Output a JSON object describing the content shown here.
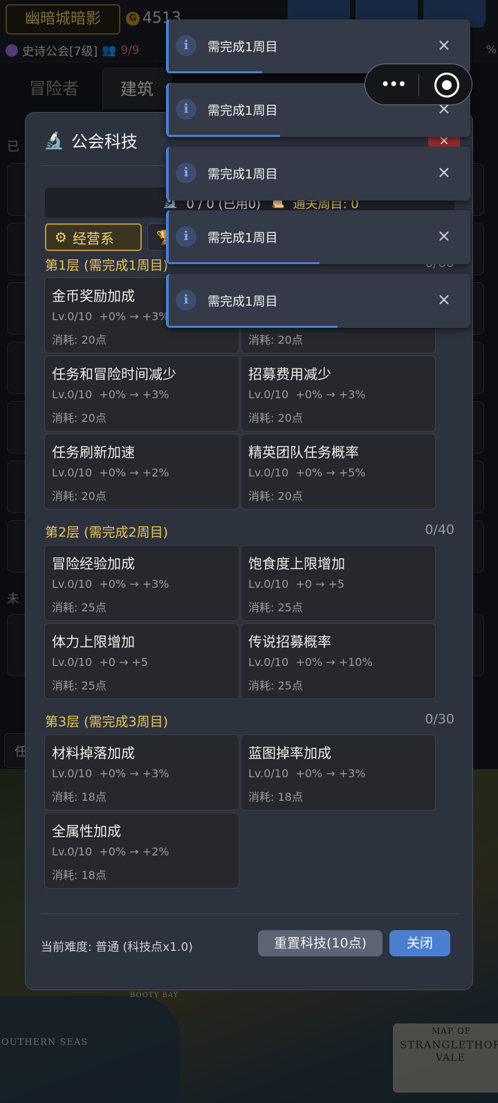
{
  "background": {
    "guild_title": "幽暗城暗影",
    "gold_value": "4513",
    "gold_icon": "G",
    "guild_info": "史诗公会[7级]",
    "member_count": "9/9",
    "percent_suffix": "%",
    "tabs": [
      "冒险者",
      "建筑"
    ],
    "left_label_1": "已",
    "left_label_2": "未",
    "strip_label": "任",
    "map_labels": {
      "southern_seas": "OUTHERN SEAS",
      "booty_bay": "BOOTY BAY",
      "map_of": "MAP OF",
      "region": "STRANGLETHOR",
      "region2": "VALE"
    }
  },
  "modal": {
    "title": "公会科技",
    "close_icon": "close-icon",
    "stats_points": "0 / 0 (已用0)",
    "stats_cycle": "通关周目: 0",
    "system_tabs": [
      {
        "label": "经营系",
        "icon": "gear-icon"
      },
      {
        "label": "",
        "icon": "trophy-icon"
      }
    ],
    "tiers": [
      {
        "title": "第1层 (需完成1周目)",
        "count": "0/60",
        "techs": [
          {
            "name": "金币奖励加成",
            "level": "Lv.0/10",
            "effect": "+0% → +3%",
            "cost": "消耗: 20点"
          },
          {
            "name": "",
            "level": "",
            "effect": "",
            "cost": "消耗: 20点"
          },
          {
            "name": "任务和冒险时间减少",
            "level": "Lv.0/10",
            "effect": "+0% → +3%",
            "cost": "消耗: 20点"
          },
          {
            "name": "招募费用减少",
            "level": "Lv.0/10",
            "effect": "+0% → +3%",
            "cost": "消耗: 20点"
          },
          {
            "name": "任务刷新加速",
            "level": "Lv.0/10",
            "effect": "+0% → +2%",
            "cost": "消耗: 20点"
          },
          {
            "name": "精英团队任务概率",
            "level": "Lv.0/10",
            "effect": "+0% → +5%",
            "cost": "消耗: 20点"
          }
        ]
      },
      {
        "title": "第2层 (需完成2周目)",
        "count": "0/40",
        "techs": [
          {
            "name": "冒险经验加成",
            "level": "Lv.0/10",
            "effect": "+0% → +3%",
            "cost": "消耗: 25点"
          },
          {
            "name": "饱食度上限增加",
            "level": "Lv.0/10",
            "effect": "+0 → +5",
            "cost": "消耗: 25点"
          },
          {
            "name": "体力上限增加",
            "level": "Lv.0/10",
            "effect": "+0 → +5",
            "cost": "消耗: 25点"
          },
          {
            "name": "传说招募概率",
            "level": "Lv.0/10",
            "effect": "+0% → +10%",
            "cost": "消耗: 25点"
          }
        ]
      },
      {
        "title": "第3层 (需完成3周目)",
        "count": "0/30",
        "techs": [
          {
            "name": "材料掉落加成",
            "level": "Lv.0/10",
            "effect": "+0% → +3%",
            "cost": "消耗: 18点"
          },
          {
            "name": "蓝图掉率加成",
            "level": "Lv.0/10",
            "effect": "+0% → +3%",
            "cost": "消耗: 18点"
          },
          {
            "name": "全属性加成",
            "level": "Lv.0/10",
            "effect": "+0% → +2%",
            "cost": "消耗: 18点"
          }
        ]
      }
    ],
    "difficulty": "当前难度: 普通 (科技点x1.0)",
    "reset_button": "重置科技(10点)",
    "close_button": "关闭"
  },
  "toasts": [
    {
      "message": "需完成1周目",
      "progress": 0.31
    },
    {
      "message": "需完成1周目",
      "progress": 0.37
    },
    {
      "message": "需完成1周目",
      "progress": 0.0
    },
    {
      "message": "需完成1周目",
      "progress": 0.5
    },
    {
      "message": "需完成1周目",
      "progress": 0.56
    }
  ],
  "colors": {
    "accent": "#4a7fd0",
    "tier_gold": "#e8c455",
    "danger": "#9a2e2e"
  }
}
